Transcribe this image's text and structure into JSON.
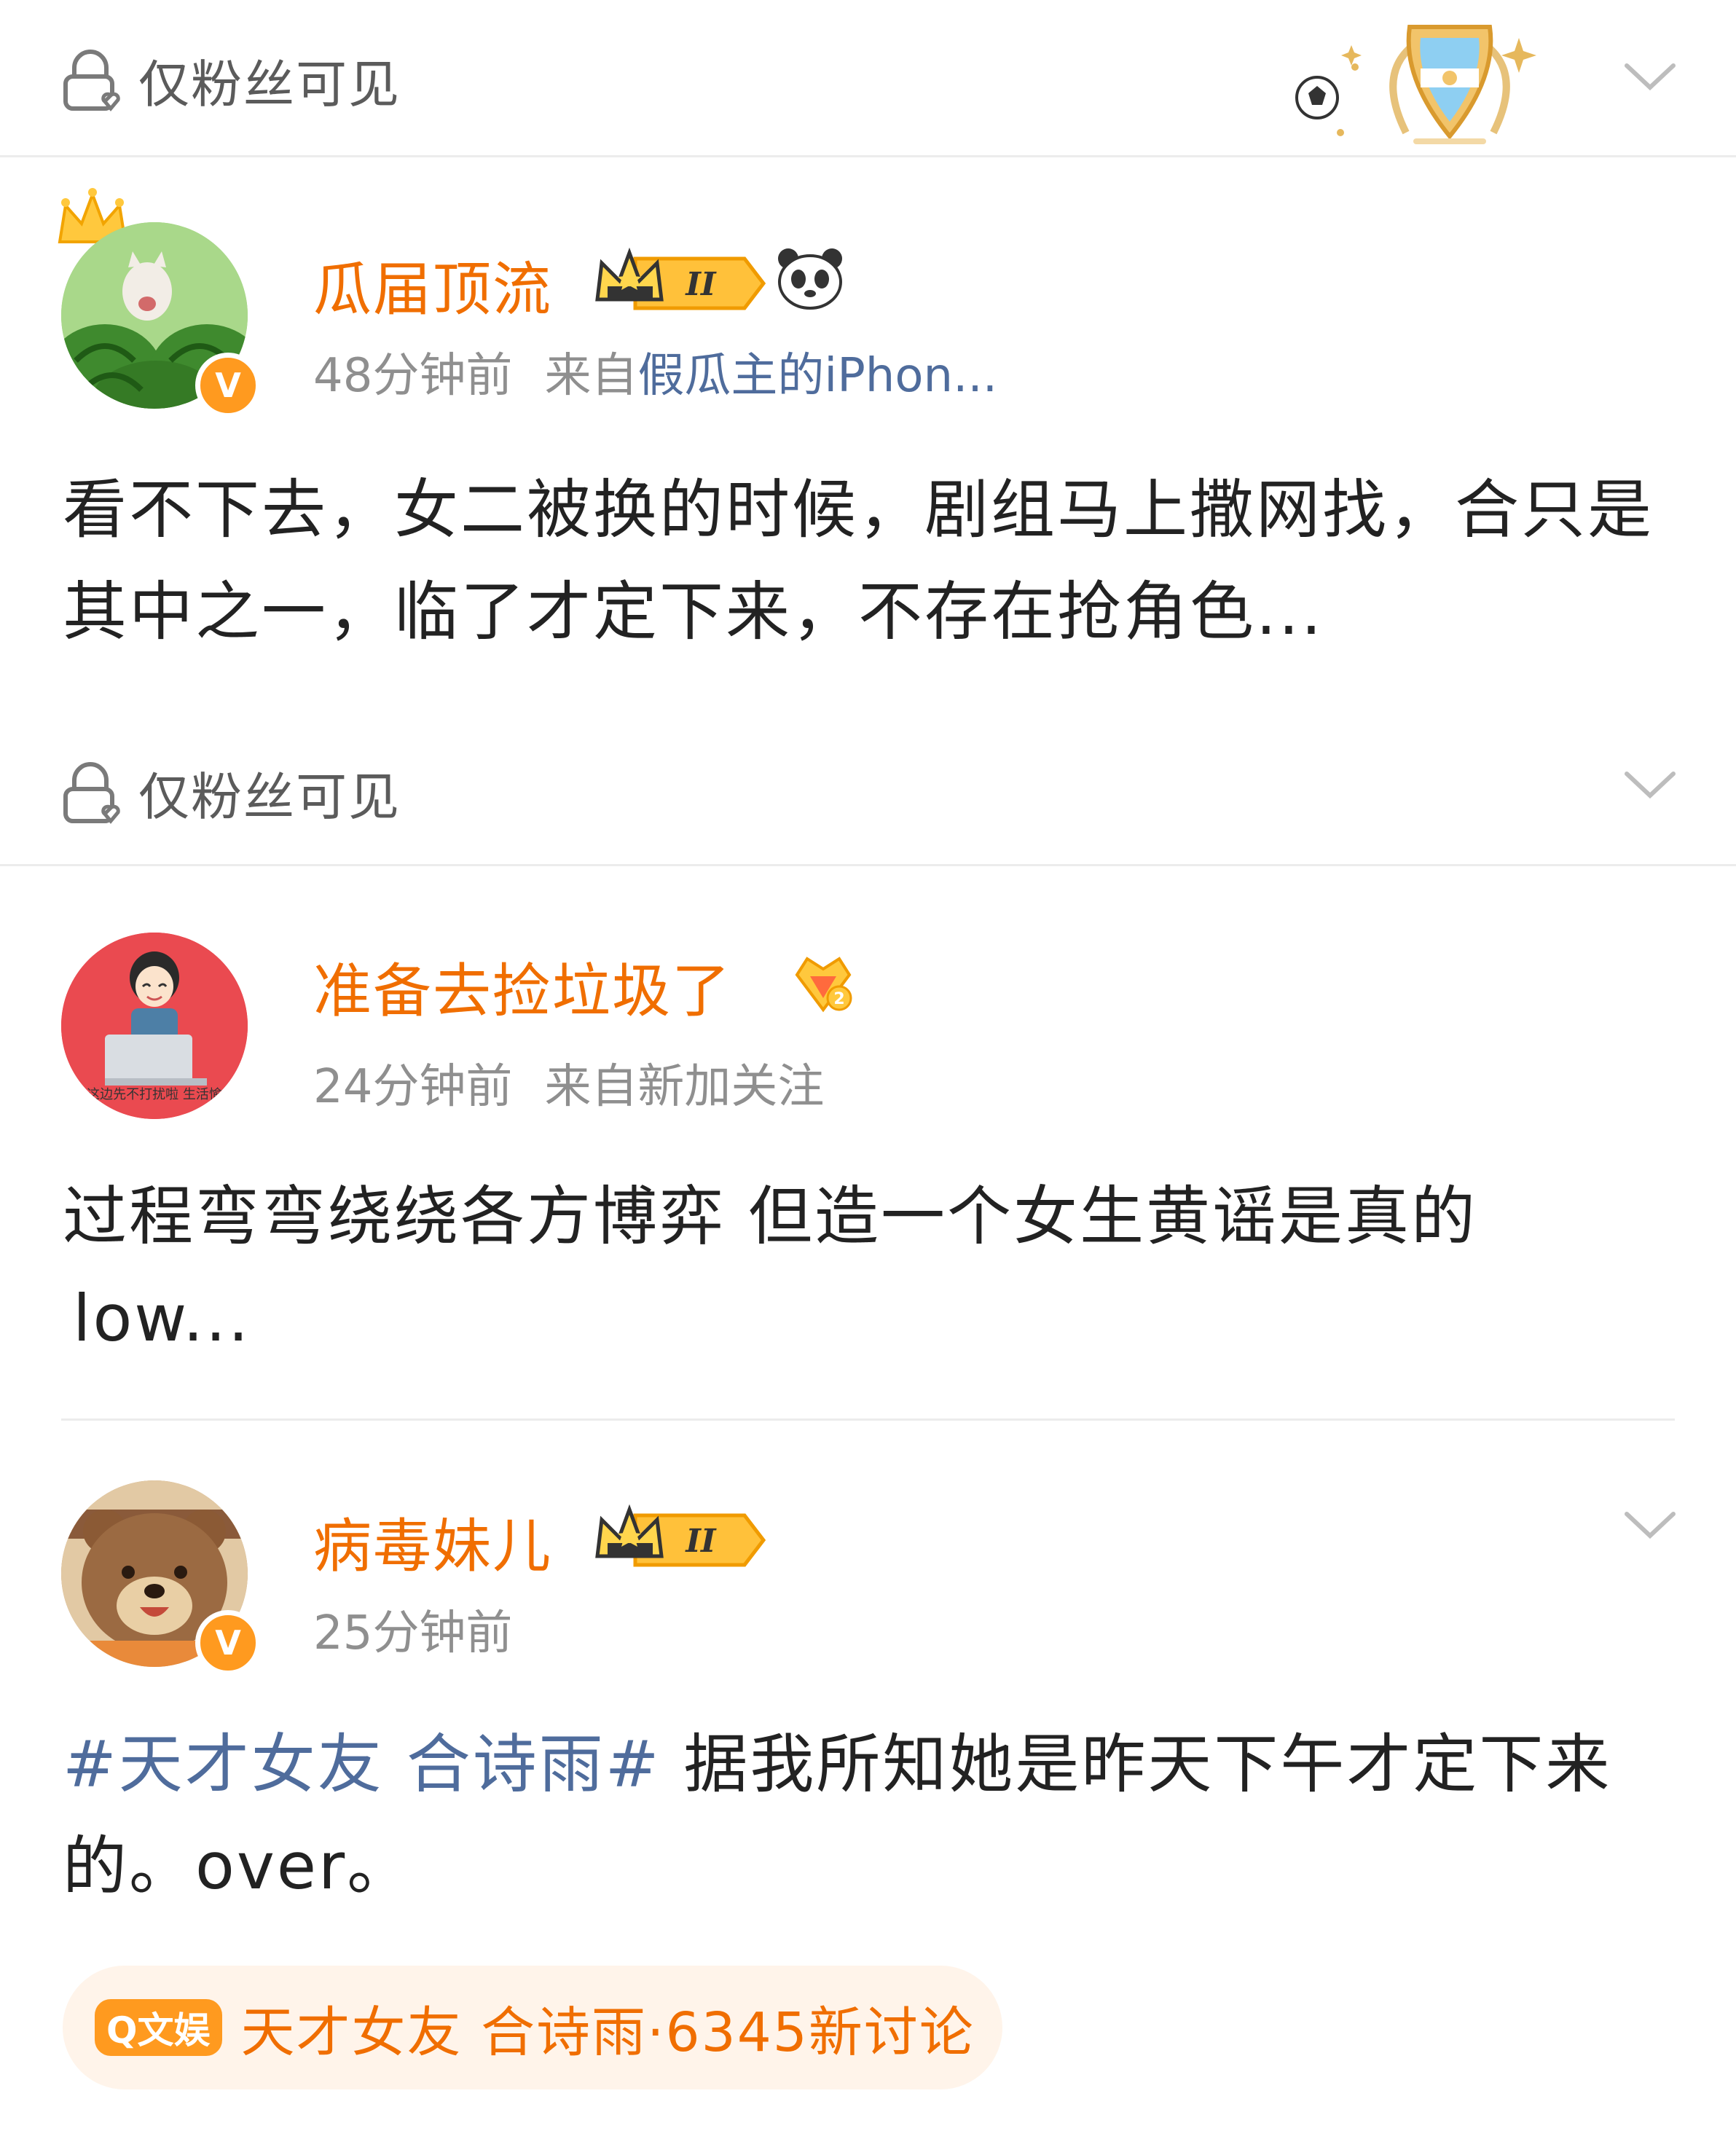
{
  "post_header": {
    "visibility": "仅粉丝可见"
  },
  "comments": [
    {
      "username": "瓜届顶流",
      "time": "48分钟前",
      "source_prefix": "来自",
      "source": "假瓜主的iPhon...",
      "text": "看不下去，女二被换的时候，剧组马上撒网找，合只是其中之一，临了才定下来，不存在抢角色...",
      "visibility": "仅粉丝可见",
      "vip_level": "II"
    },
    {
      "username": "准备去捡垃圾了",
      "time": "24分钟前",
      "source": "来自新加关注",
      "text_line1": "过程弯弯绕绕各方博弈 但造一个女生黄谣是真的",
      "text_line2": "low...",
      "avatar_caption": "我这边先不打扰啦 生活愉快"
    },
    {
      "username": "病毒妹儿",
      "time": "25分钟前",
      "topic": "#天才女友 合诗雨#",
      "text_rest": " 据我所知她是昨天下午才定下来的。over。",
      "vip_level": "II",
      "topic_card": {
        "tag": "Q文娱",
        "text": "天才女友 合诗雨·6345新讨论"
      }
    }
  ],
  "colors": {
    "username": "#f06e00",
    "link": "#4f6c9c",
    "meta": "#8f8f8f",
    "verified_badge": "#ff9a1f"
  },
  "icons": [
    "lock-icon",
    "chevron-down-icon",
    "argentina-shield-icon",
    "soccer-ball-icon",
    "crown-badge-icon",
    "panda-icon",
    "verified-badge-icon"
  ]
}
